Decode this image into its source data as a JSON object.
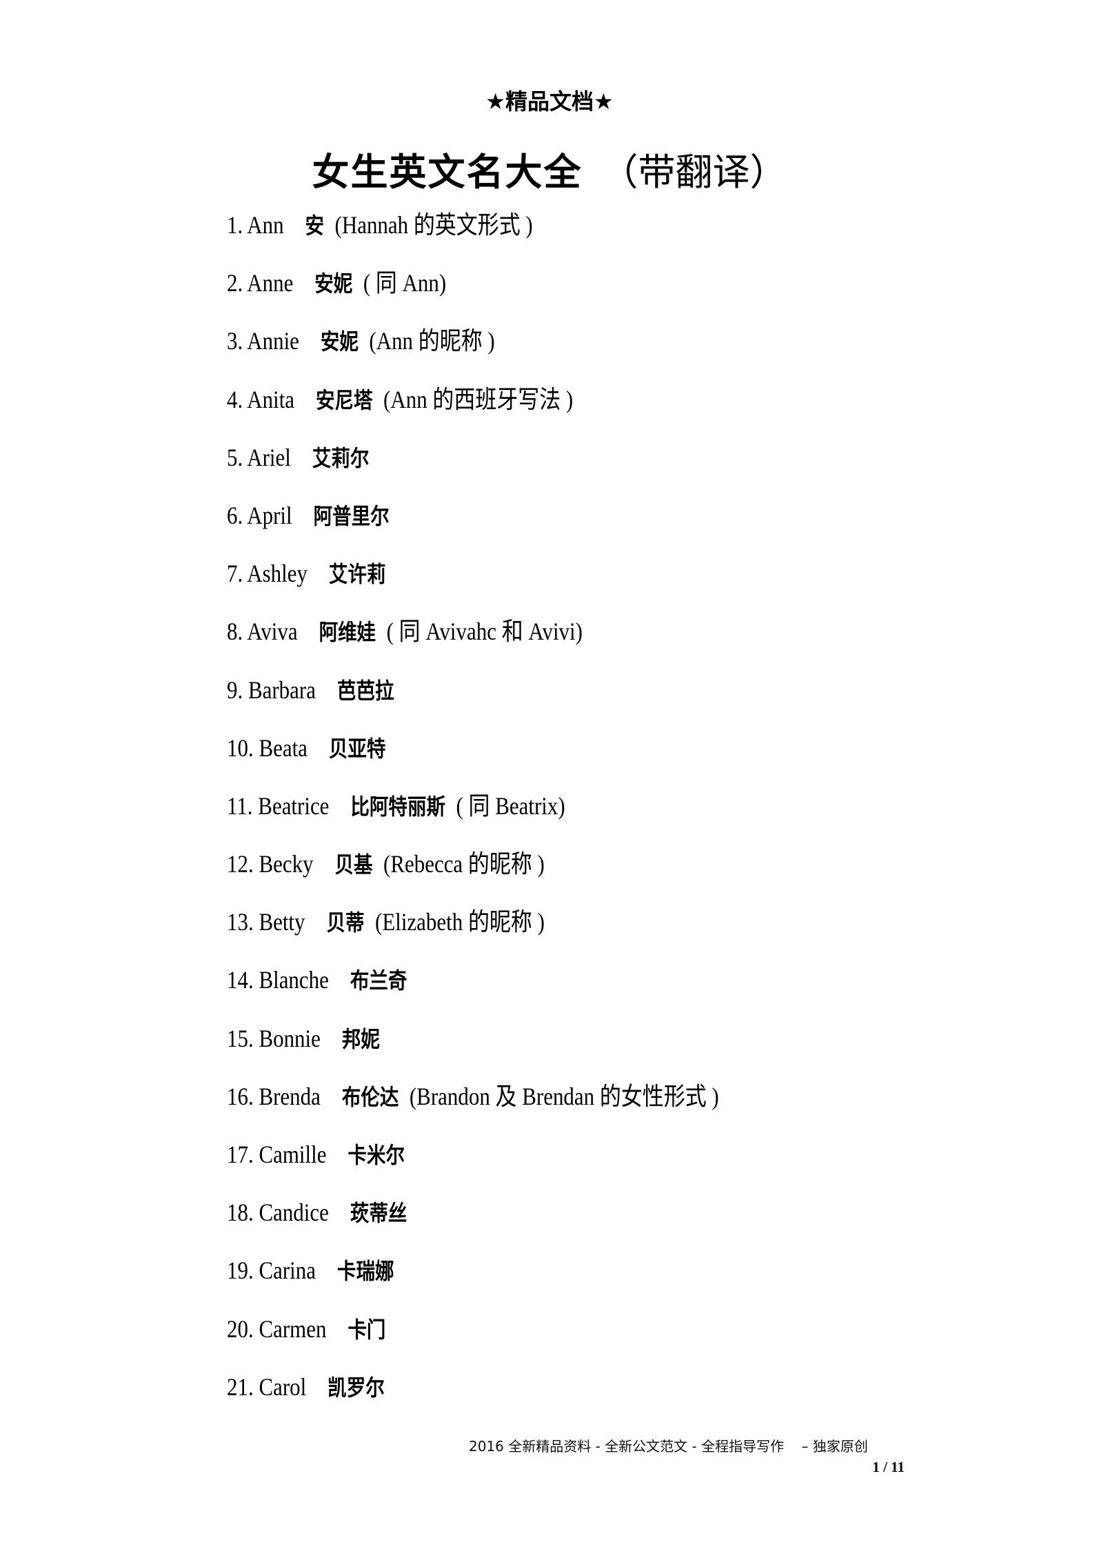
{
  "header": {
    "label": "★精品文档★"
  },
  "title": {
    "main": "女生英文名大全",
    "sub": "（带翻译）"
  },
  "names": [
    {
      "num": "1.",
      "en": "Ann",
      "cn": "安",
      "note": "(Hannah 的英文形式 )"
    },
    {
      "num": "2.",
      "en": "Anne",
      "cn": "安妮",
      "note": "( 同 Ann)"
    },
    {
      "num": "3.",
      "en": "Annie",
      "cn": "安妮",
      "note": "(Ann 的昵称 )"
    },
    {
      "num": "4.",
      "en": "Anita",
      "cn": "安尼塔",
      "note": "(Ann 的西班牙写法 )"
    },
    {
      "num": "5.",
      "en": "Ariel",
      "cn": "艾莉尔",
      "note": ""
    },
    {
      "num": "6.",
      "en": "April",
      "cn": "阿普里尔",
      "note": ""
    },
    {
      "num": "7.",
      "en": "Ashley",
      "cn": "艾许莉",
      "note": ""
    },
    {
      "num": "8.",
      "en": "Aviva",
      "cn": "阿维娃",
      "note": "( 同 Avivahc 和 Avivi)"
    },
    {
      "num": "9.",
      "en": "Barbara",
      "cn": "芭芭拉",
      "note": ""
    },
    {
      "num": "10.",
      "en": "Beata",
      "cn": "贝亚特",
      "note": ""
    },
    {
      "num": "11.",
      "en": "Beatrice",
      "cn": "比阿特丽斯",
      "note": "( 同 Beatrix)"
    },
    {
      "num": "12.",
      "en": "Becky",
      "cn": "贝基",
      "note": "(Rebecca 的昵称 )"
    },
    {
      "num": "13.",
      "en": "Betty",
      "cn": "贝蒂",
      "note": "(Elizabeth 的昵称 )"
    },
    {
      "num": "14.",
      "en": "Blanche",
      "cn": "布兰奇",
      "note": ""
    },
    {
      "num": "15.",
      "en": "Bonnie",
      "cn": "邦妮",
      "note": ""
    },
    {
      "num": "16.",
      "en": "Brenda",
      "cn": "布伦达",
      "note": "(Brandon 及 Brendan 的女性形式 )"
    },
    {
      "num": "17.",
      "en": "Camille",
      "cn": "卡米尔",
      "note": ""
    },
    {
      "num": "18.",
      "en": "Candice",
      "cn": "莰蒂丝",
      "note": ""
    },
    {
      "num": "19.",
      "en": "Carina",
      "cn": "卡瑞娜",
      "note": ""
    },
    {
      "num": "20.",
      "en": "Carmen",
      "cn": "卡门",
      "note": ""
    },
    {
      "num": "21.",
      "en": "Carol",
      "cn": "凯罗尔",
      "note": ""
    }
  ],
  "footer": {
    "text": "2016 全新精品资料 - 全新公文范文 - 全程指导写作    – 独家原创",
    "page": "1 / 11"
  }
}
